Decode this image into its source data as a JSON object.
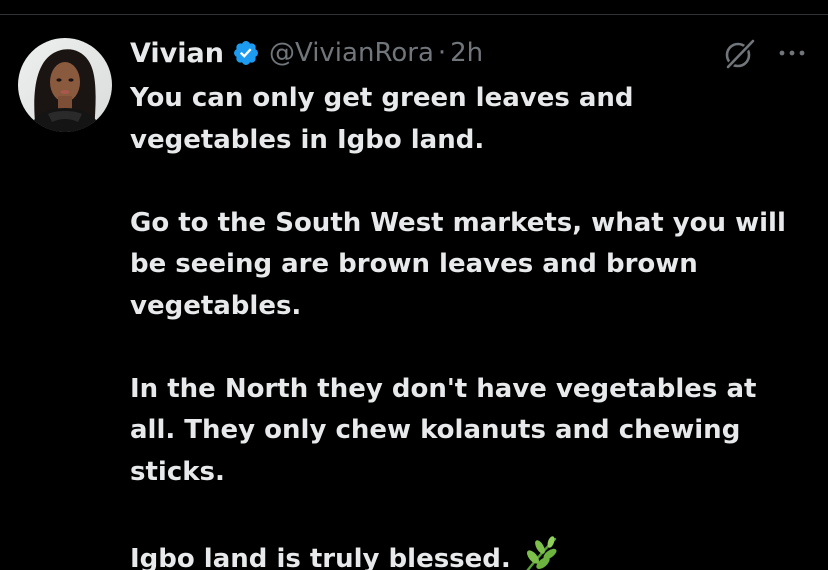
{
  "colors": {
    "background": "#000000",
    "primary_text": "#e7e9ea",
    "secondary_text": "#71767b",
    "verified_badge": "#1d9bf0",
    "divider": "#2f3336"
  },
  "tweet": {
    "author": {
      "display_name": "Vivian",
      "handle": "@VivianRora",
      "verified": true,
      "avatar_icon": "profile-photo"
    },
    "separator": "·",
    "timestamp": "2h",
    "header_icons": [
      "grok-icon",
      "more-icon"
    ],
    "lines": [
      "You can only get green leaves and",
      "vegetables in Igbo land.",
      "",
      "Go to the South West markets, what you will",
      "be seeing are brown leaves and brown",
      "vegetables.",
      "",
      "In the North they don't have vegetables at",
      "all. They only chew kolanuts and chewing",
      "sticks.",
      "",
      "Igbo land is truly blessed."
    ],
    "trailing_emoji": "herb-emoji"
  }
}
